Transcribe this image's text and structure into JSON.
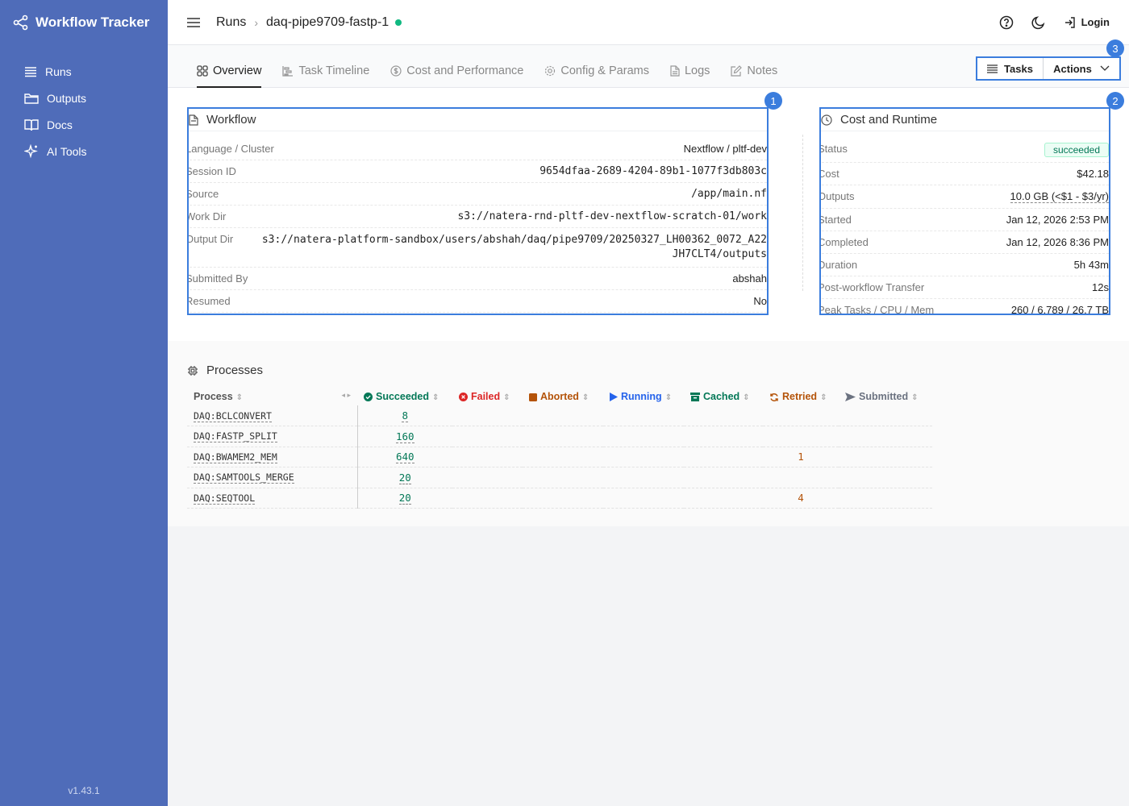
{
  "app": {
    "title": "Workflow Tracker",
    "version": "v1.43.1"
  },
  "sidebar": {
    "items": [
      {
        "label": "Runs",
        "icon": "list-icon"
      },
      {
        "label": "Outputs",
        "icon": "folder-icon"
      },
      {
        "label": "Docs",
        "icon": "book-icon"
      },
      {
        "label": "AI Tools",
        "icon": "sparkle-icon"
      }
    ]
  },
  "header": {
    "breadcrumb_root": "Runs",
    "run_name": "daq-pipe9709-fastp-1",
    "login_label": "Login"
  },
  "tabs": [
    {
      "label": "Overview",
      "active": true
    },
    {
      "label": "Task Timeline"
    },
    {
      "label": "Cost and Performance"
    },
    {
      "label": "Config & Params"
    },
    {
      "label": "Logs"
    },
    {
      "label": "Notes"
    }
  ],
  "toolbar": {
    "tasks_label": "Tasks",
    "actions_label": "Actions"
  },
  "badges": [
    "1",
    "2",
    "3"
  ],
  "workflow": {
    "title": "Workflow",
    "rows": [
      {
        "key": "Language / Cluster",
        "value": "Nextflow / pltf-dev"
      },
      {
        "key": "Session ID",
        "value": "9654dfaa-2689-4204-89b1-1077f3db803c"
      },
      {
        "key": "Source",
        "value": "/app/main.nf"
      },
      {
        "key": "Work Dir",
        "value": "s3://natera-rnd-pltf-dev-nextflow-scratch-01/work"
      },
      {
        "key": "Output Dir",
        "value": "s3://natera-platform-sandbox/users/abshah/daq/pipe9709/20250327_LH00362_0072_A22",
        "value2": "JH7CLT4/outputs"
      },
      {
        "key": "Submitted By",
        "value": "abshah"
      },
      {
        "key": "Resumed",
        "value": "No"
      }
    ]
  },
  "cost": {
    "title": "Cost and Runtime",
    "status_label": "Status",
    "status_value": "succeeded",
    "rows": [
      {
        "key": "Cost",
        "value": "$42.18"
      },
      {
        "key": "Outputs",
        "value": "10.0 GB (<$1 - $3/yr)"
      },
      {
        "key": "Started",
        "value": "Jan 12, 2026 2:53 PM"
      },
      {
        "key": "Completed",
        "value": "Jan 12, 2026 8:36 PM"
      },
      {
        "key": "Duration",
        "value": "5h 43m"
      },
      {
        "key": "Post-workflow Transfer",
        "value": "12s"
      },
      {
        "key": "Peak Tasks / CPU / Mem",
        "value": "260 / 6,789 / 26.7 TB"
      }
    ]
  },
  "processes": {
    "title": "Processes",
    "columns": {
      "process": "Process",
      "succeeded": "Succeeded",
      "failed": "Failed",
      "aborted": "Aborted",
      "running": "Running",
      "cached": "Cached",
      "retried": "Retried",
      "submitted": "Submitted"
    },
    "rows": [
      {
        "name": "DAQ:BCLCONVERT",
        "succeeded": "8",
        "retried": ""
      },
      {
        "name": "DAQ:FASTP_SPLIT",
        "succeeded": "160",
        "retried": ""
      },
      {
        "name": "DAQ:BWAMEM2_MEM",
        "succeeded": "640",
        "retried": "1"
      },
      {
        "name": "DAQ:SAMTOOLS_MERGE",
        "succeeded": "20",
        "retried": ""
      },
      {
        "name": "DAQ:SEQTOOL",
        "succeeded": "20",
        "retried": "4"
      }
    ]
  },
  "colors": {
    "sidebar": "#4f6cb9",
    "accent": "#3b7ddd",
    "success": "#047857",
    "failed": "#dc2626",
    "aborted": "#b45309",
    "running": "#2563eb"
  }
}
